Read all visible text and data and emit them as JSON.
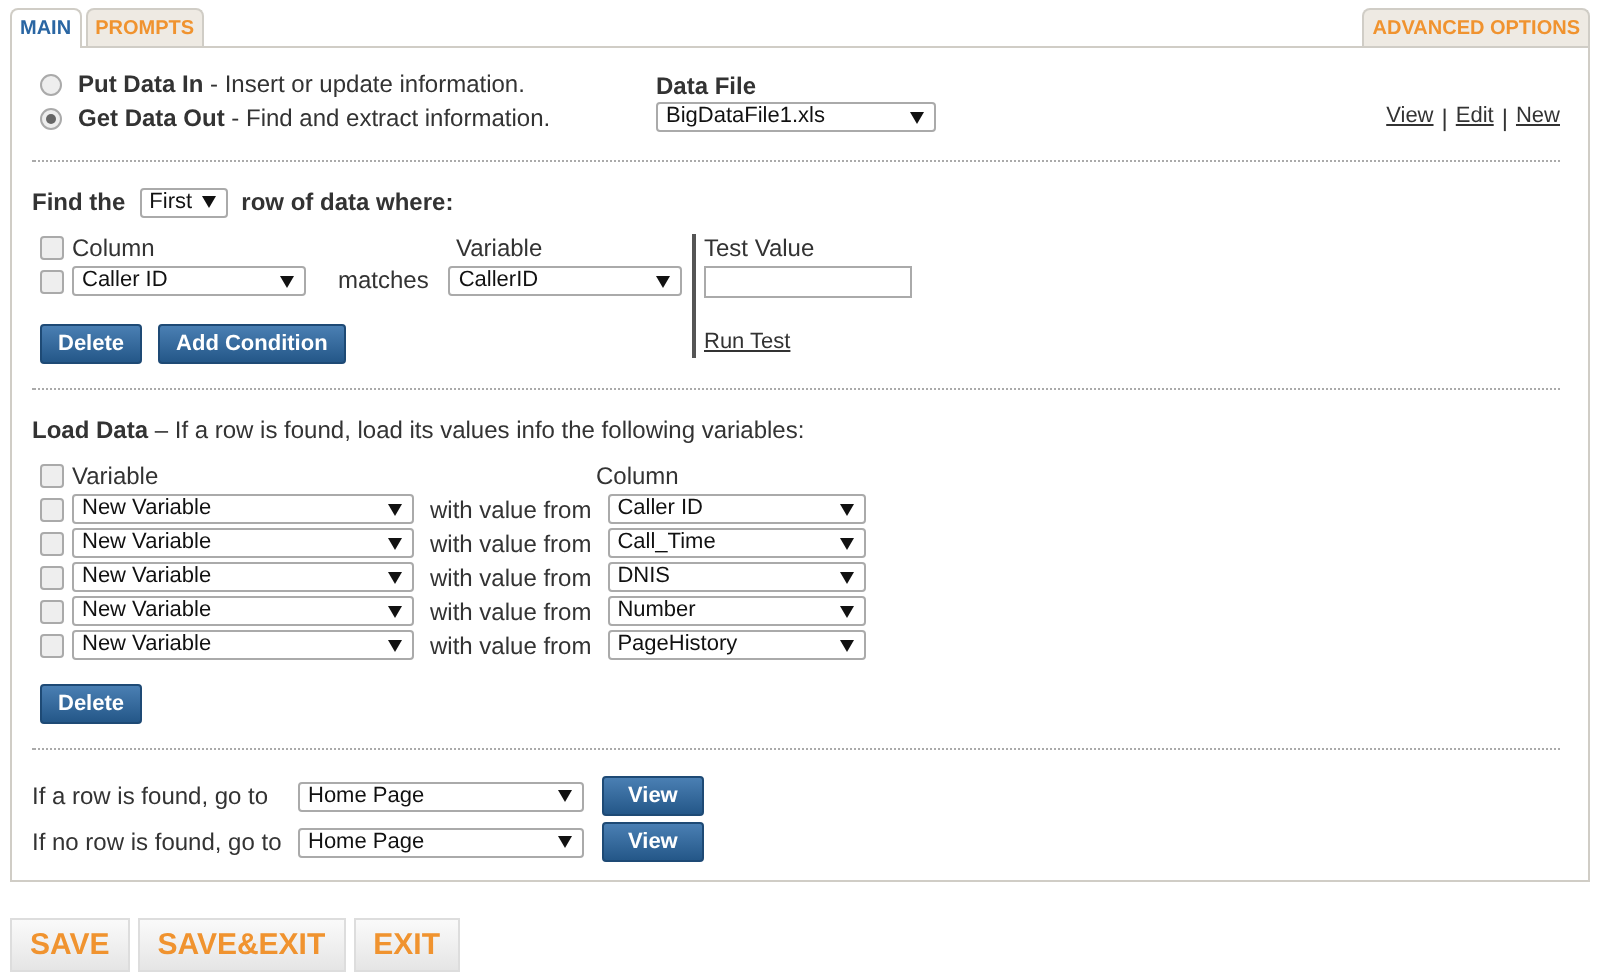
{
  "tabs": [
    {
      "label": "MAIN",
      "selected": true
    },
    {
      "label": "PROMPTS",
      "selected": false
    }
  ],
  "advanced_tab": {
    "label": "ADVANCED OPTIONS",
    "selected": false
  },
  "mode_options": [
    {
      "text": "**Put Data In** - Insert or update information.",
      "selected": false
    },
    {
      "text": "**Get Data Out** - Find and extract information.",
      "selected": true
    }
  ],
  "data_file": {
    "label": "Data File",
    "value": "BigDataFile1.xls",
    "links": [
      "View",
      "Edit",
      "New"
    ],
    "separators": [
      "|",
      "|"
    ]
  },
  "find": {
    "prefix": "Find the",
    "occurrence": "First",
    "suffix": "row of data where:"
  },
  "conditions": {
    "header_checked": false,
    "column_header": "Column",
    "variable_header": "Variable",
    "test_value_label": "Test Value",
    "rows": [
      {
        "checked": false,
        "column": "Caller ID",
        "operator": "matches",
        "variable": "CallerID"
      }
    ],
    "buttons": [
      "Delete",
      "Add Condition"
    ],
    "run_test": "Run Test"
  },
  "load": {
    "text": "**Load Data** – If a row is found, load its values info the following variables:",
    "header_checked": false,
    "variable_header": "Variable",
    "column_header": "Column",
    "rows": [
      {
        "checked": false,
        "variable": "New Variable",
        "connector": "with value from",
        "column": "Caller ID"
      },
      {
        "checked": false,
        "variable": "New Variable",
        "connector": "with value from",
        "column": "Call_Time"
      },
      {
        "checked": false,
        "variable": "New Variable",
        "connector": "with value from",
        "column": "DNIS"
      },
      {
        "checked": false,
        "variable": "New Variable",
        "connector": "with value from",
        "column": "Number"
      },
      {
        "checked": false,
        "variable": "New Variable",
        "connector": "with value from",
        "column": "PageHistory"
      }
    ],
    "buttons": [
      "Delete"
    ]
  },
  "goto": [
    {
      "label": "If a row is found, go to",
      "page": "Home Page",
      "button": "View"
    },
    {
      "label": "If no row is found, go to",
      "page": "Home Page",
      "button": "View"
    }
  ],
  "footer_buttons": [
    "SAVE",
    "SAVE&EXIT",
    "EXIT"
  ]
}
